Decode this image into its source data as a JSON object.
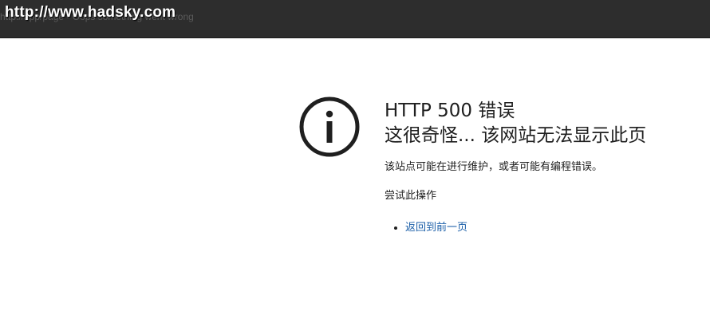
{
  "header": {
    "watermark_url": "http://www.hadsky.com",
    "ghost_url": "http://app/page - Oops something went wrong"
  },
  "icon": {
    "name": "info-icon"
  },
  "error": {
    "title": "HTTP 500 错误",
    "subtitle": "这很奇怪... 该网站无法显示此页",
    "description": "该站点可能在进行维护，或者可能有编程错误。",
    "try_heading": "尝试此操作",
    "actions": [
      {
        "label": "返回到前一页"
      }
    ]
  },
  "colors": {
    "header_bg": "#2d2d2d",
    "text": "#1f1f1f",
    "link": "#1a5ea8"
  }
}
